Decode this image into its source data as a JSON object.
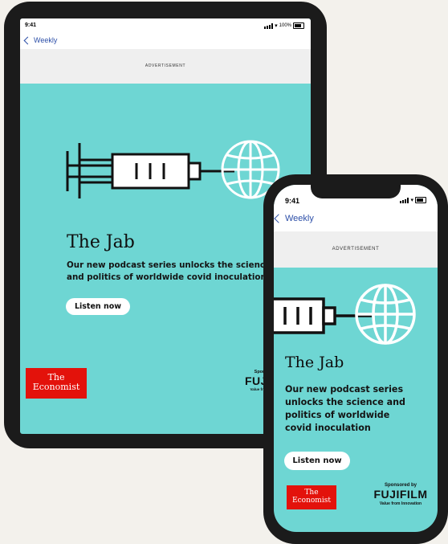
{
  "status_bar": {
    "time": "9:41",
    "battery": "100%"
  },
  "nav": {
    "back_label": "Weekly"
  },
  "ad": {
    "label": "ADVERTISEMENT"
  },
  "promo": {
    "title": "The Jab",
    "description": "Our new podcast series unlocks the science and politics of worldwide covid inoculation",
    "cta": "Listen now"
  },
  "brand_logo": {
    "line1": "The",
    "line2": "Economist"
  },
  "sponsor": {
    "label": "Sponsored by",
    "name": "FUJIFILM",
    "tagline": "Value from Innovation"
  },
  "colors": {
    "background": "#6ed6d3",
    "logo_red": "#e3120b",
    "link_blue": "#2d4fa8"
  },
  "icons": [
    "syringe-icon",
    "globe-icon",
    "chevron-left-icon",
    "signal-icon",
    "wifi-icon",
    "battery-icon"
  ]
}
